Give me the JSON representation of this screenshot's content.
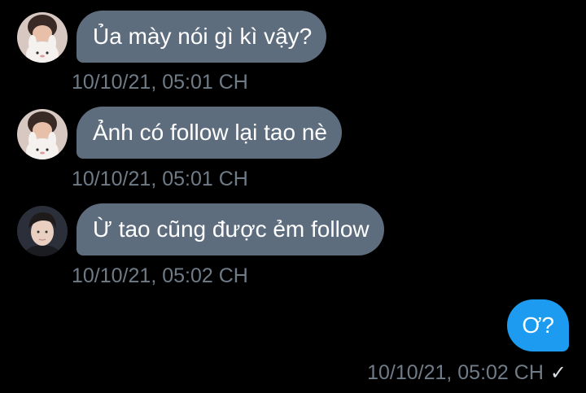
{
  "messages": [
    {
      "direction": "received",
      "avatar": "bunny-plush-avatar",
      "text": "Ủa mày nói gì kì vậy?",
      "time": "10/10/21, 05:01 CH"
    },
    {
      "direction": "received",
      "avatar": "bunny-plush-avatar",
      "text": "Ảnh có follow lại tao nè",
      "time": "10/10/21, 05:01 CH"
    },
    {
      "direction": "received",
      "avatar": "person-portrait-avatar",
      "text": "Ừ tao cũng được ẻm follow",
      "time": "10/10/21, 05:02 CH"
    },
    {
      "direction": "sent",
      "text": "Ơ?",
      "time": "10/10/21, 05:02 CH",
      "status_icon": "check-icon"
    }
  ],
  "colors": {
    "background": "#000000",
    "received_bubble": "#5e6d7e",
    "sent_bubble": "#1d9bf0",
    "timestamp": "#6f7c88"
  }
}
